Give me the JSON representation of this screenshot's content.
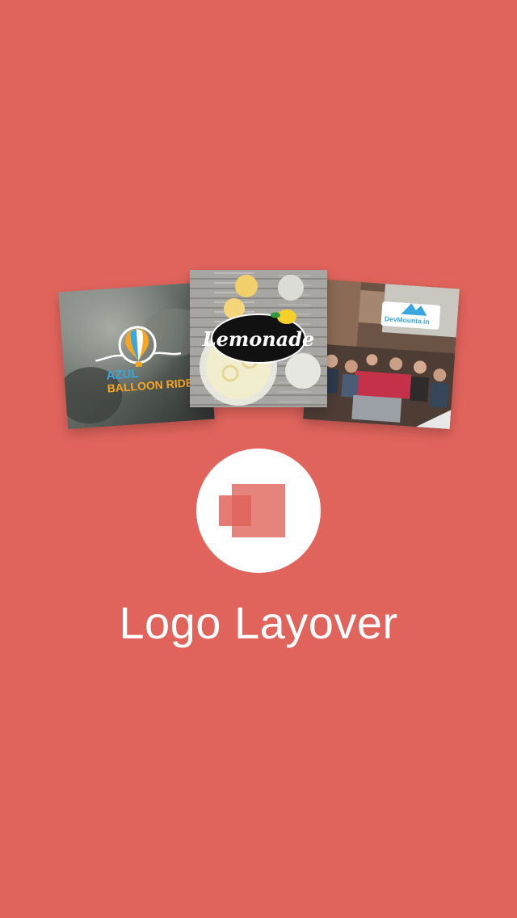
{
  "app": {
    "title": "Logo Layover"
  },
  "sample_cards": {
    "left": {
      "logo_line1": "AZUL",
      "logo_line2": "BALLOON RIDES"
    },
    "center": {
      "logo_text": "Lemonade"
    },
    "right": {
      "logo_text": "DevMounta.in"
    }
  },
  "colors": {
    "background": "#e0645c",
    "icon_circle": "#ffffff",
    "icon_square": "#e0645c"
  }
}
